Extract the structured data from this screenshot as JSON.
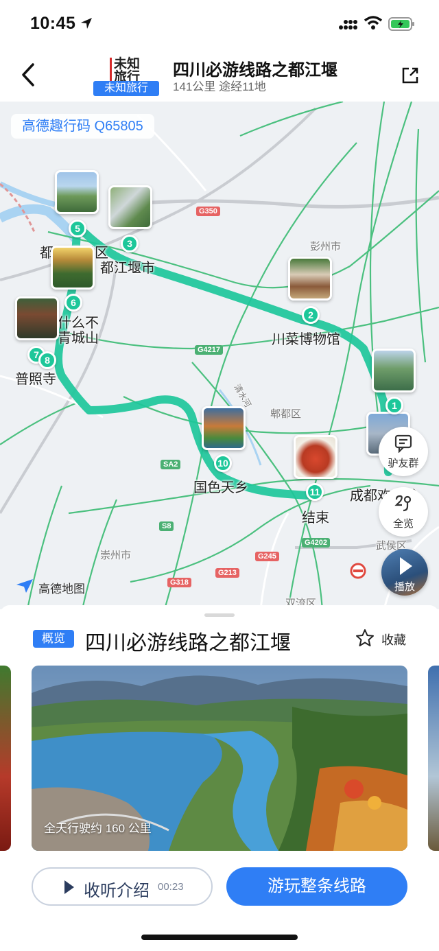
{
  "status_bar": {
    "time": "10:45"
  },
  "header": {
    "logo_text": "未知旅行",
    "brand_badge": "未知旅行",
    "title": "四川必游线路之都江堰",
    "subtitle": "141公里 途经11地"
  },
  "map": {
    "code_chip": "高德趣行码 Q65805",
    "labels": {
      "dujiangyan_area": "都江堰景区",
      "dujiangyan_city": "都江堰市",
      "qingchengshan": "什么不 青城山",
      "puzhaosi": "普照寺",
      "sichuan_cuisine_museum": "川菜博物馆",
      "guose_tianxiang": "国色天乡",
      "end": "结束",
      "chengdu": "成都欢乐谷",
      "pengzhou": "彭州市",
      "pixian": "郫都区",
      "chongzhou": "崇州市",
      "wuhou": "武侯区",
      "shuangliu": "双流区",
      "zoujiang": "清水河"
    },
    "road_signs": [
      "G350",
      "G4217",
      "SA2",
      "S8",
      "G213",
      "G245",
      "G318",
      "G4202"
    ],
    "stops": [
      "1",
      "2",
      "3",
      "5",
      "6",
      "7",
      "8",
      "9",
      "10",
      "11"
    ],
    "side_buttons": {
      "group": "驴友群",
      "overview": "全览",
      "play": "播放"
    },
    "provider": "高德地图"
  },
  "sheet": {
    "badge": "概览",
    "title": "四川必游线路之都江堰",
    "favorite": "收藏",
    "card_caption": "全天行驶约 160 公里",
    "listen_label": "收听介绍",
    "listen_duration": "00:23",
    "play_route": "游玩整条线路"
  },
  "colors": {
    "accent": "#2f7ef5",
    "route": "#1dc79a"
  }
}
